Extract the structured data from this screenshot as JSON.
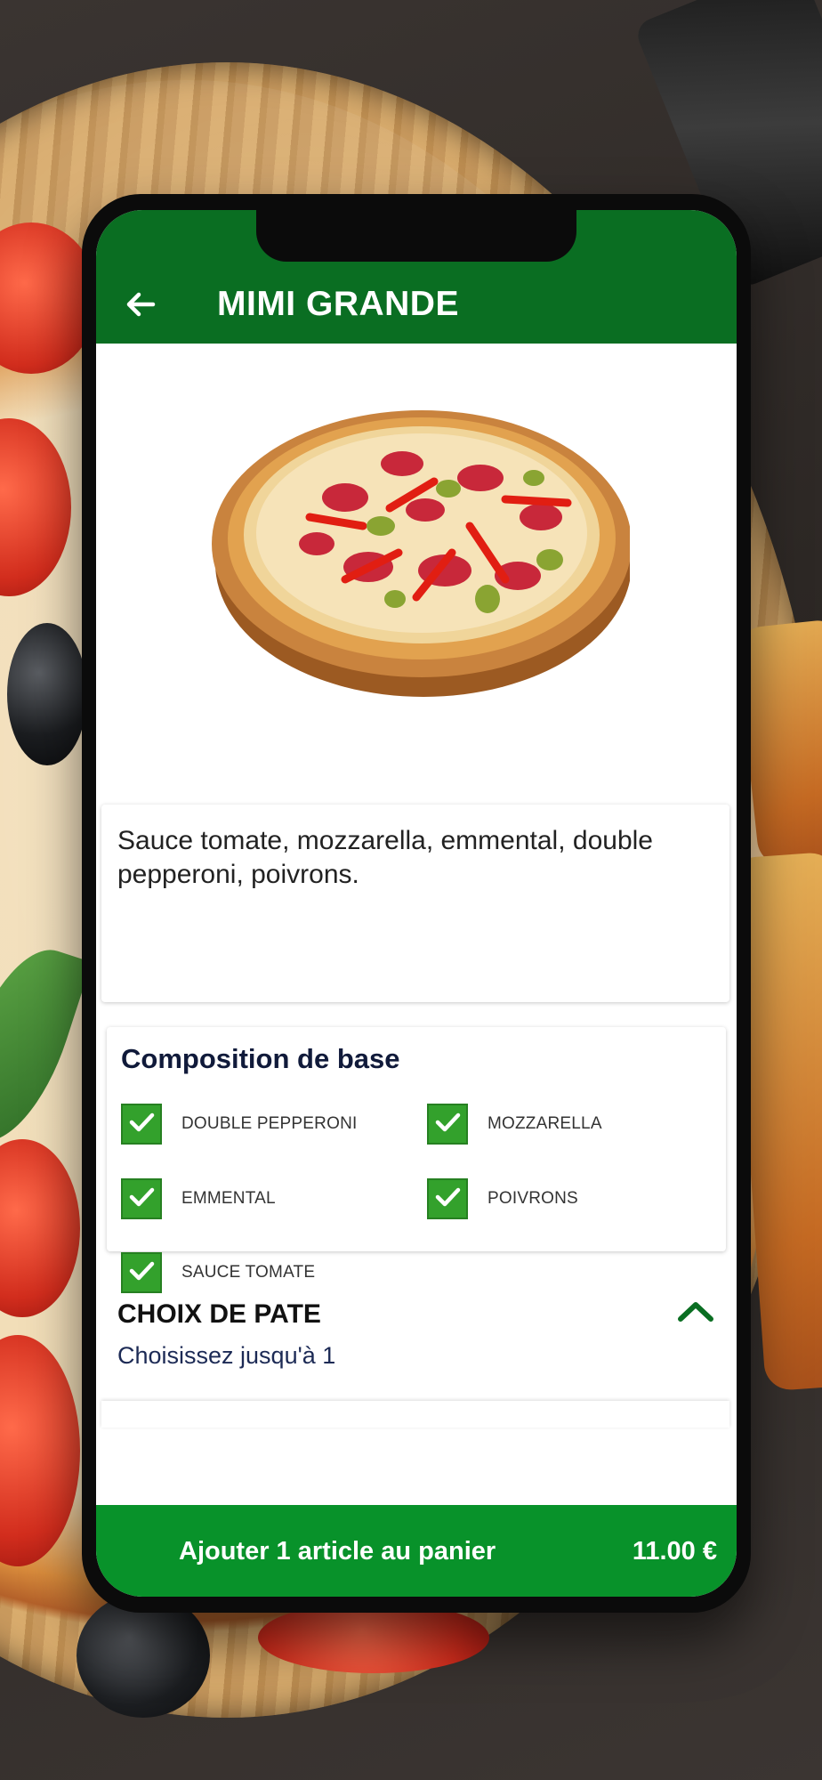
{
  "header": {
    "title": "MIMI GRANDE",
    "back_icon": "arrow-left-icon"
  },
  "product": {
    "description": "Sauce tomate, mozzarella, emmental, double pepperoni, poivrons."
  },
  "composition": {
    "title": "Composition de base",
    "items": [
      {
        "label": "DOUBLE PEPPERONI",
        "checked": true
      },
      {
        "label": "MOZZARELLA",
        "checked": true
      },
      {
        "label": "EMMENTAL",
        "checked": true
      },
      {
        "label": "POIVRONS",
        "checked": true
      },
      {
        "label": "SAUCE TOMATE",
        "checked": true
      }
    ]
  },
  "pate": {
    "title": "CHOIX DE PATE",
    "subtitle": "Choisissez jusqu'à 1",
    "expanded": true
  },
  "cart": {
    "label": "Ajouter 1 article au panier",
    "price": "11.00 €"
  },
  "colors": {
    "appbar": "#0a6e22",
    "checkbox": "#33a12c",
    "cta": "#08922a"
  }
}
